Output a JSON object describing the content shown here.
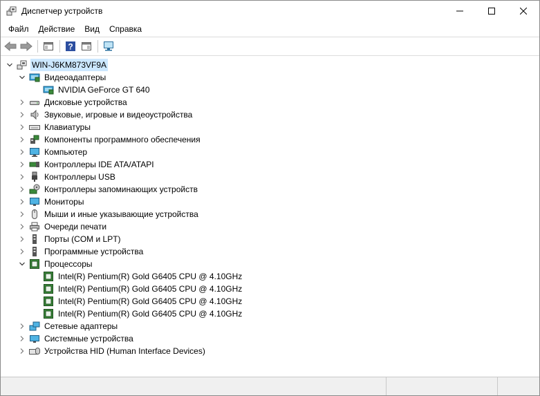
{
  "window": {
    "title": "Диспетчер устройств"
  },
  "menu": [
    "Файл",
    "Действие",
    "Вид",
    "Справка"
  ],
  "toolbar": {
    "buttons": [
      "back-icon",
      "forward-icon",
      "properties-icon",
      "help-icon",
      "console-tree-icon",
      "scan-hardware-icon"
    ]
  },
  "tree": {
    "root": "WIN-J6KM873VF9A",
    "categories": [
      {
        "label": "Видеоадаптеры",
        "icon": "display-adapter-icon",
        "expanded": true,
        "children": [
          "NVIDIA GeForce GT 640"
        ]
      },
      {
        "label": "Дисковые устройства",
        "icon": "disk-drive-icon",
        "expanded": false
      },
      {
        "label": "Звуковые, игровые и видеоустройства",
        "icon": "speaker-icon",
        "expanded": false
      },
      {
        "label": "Клавиатуры",
        "icon": "keyboard-icon",
        "expanded": false
      },
      {
        "label": "Компоненты программного обеспечения",
        "icon": "software-component-icon",
        "expanded": false
      },
      {
        "label": "Компьютер",
        "icon": "computer-icon",
        "expanded": false
      },
      {
        "label": "Контроллеры IDE ATA/ATAPI",
        "icon": "ide-controller-icon",
        "expanded": false
      },
      {
        "label": "Контроллеры USB",
        "icon": "usb-icon",
        "expanded": false
      },
      {
        "label": "Контроллеры запоминающих устройств",
        "icon": "storage-controller-icon",
        "expanded": false
      },
      {
        "label": "Мониторы",
        "icon": "monitor-icon",
        "expanded": false
      },
      {
        "label": "Мыши и иные указывающие устройства",
        "icon": "mouse-icon",
        "expanded": false
      },
      {
        "label": "Очереди печати",
        "icon": "printer-icon",
        "expanded": false
      },
      {
        "label": "Порты (COM и LPT)",
        "icon": "port-icon",
        "expanded": false
      },
      {
        "label": "Программные устройства",
        "icon": "software-device-icon",
        "expanded": false
      },
      {
        "label": "Процессоры",
        "icon": "processor-icon",
        "expanded": true,
        "children": [
          "Intel(R) Pentium(R) Gold G6405 CPU @ 4.10GHz",
          "Intel(R) Pentium(R) Gold G6405 CPU @ 4.10GHz",
          "Intel(R) Pentium(R) Gold G6405 CPU @ 4.10GHz",
          "Intel(R) Pentium(R) Gold G6405 CPU @ 4.10GHz"
        ]
      },
      {
        "label": "Сетевые адаптеры",
        "icon": "network-adapter-icon",
        "expanded": false
      },
      {
        "label": "Системные устройства",
        "icon": "system-device-icon",
        "expanded": false
      },
      {
        "label": "Устройства HID (Human Interface Devices)",
        "icon": "hid-icon",
        "expanded": false
      }
    ]
  }
}
